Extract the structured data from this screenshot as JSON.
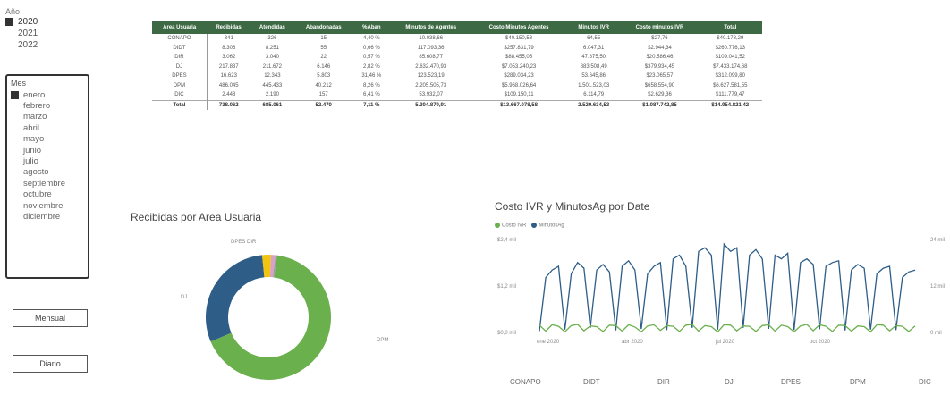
{
  "year_slicer": {
    "title": "Año",
    "items": [
      {
        "label": "2020",
        "selected": true
      },
      {
        "label": "2021",
        "selected": false
      },
      {
        "label": "2022",
        "selected": false
      }
    ]
  },
  "month_slicer": {
    "title": "Mes",
    "items": [
      {
        "label": "enero",
        "selected": true
      },
      {
        "label": "febrero",
        "selected": false
      },
      {
        "label": "marzo",
        "selected": false
      },
      {
        "label": "abril",
        "selected": false
      },
      {
        "label": "mayo",
        "selected": false
      },
      {
        "label": "junio",
        "selected": false
      },
      {
        "label": "julio",
        "selected": false
      },
      {
        "label": "agosto",
        "selected": false
      },
      {
        "label": "septiembre",
        "selected": false
      },
      {
        "label": "octubre",
        "selected": false
      },
      {
        "label": "noviembre",
        "selected": false
      },
      {
        "label": "diciembre",
        "selected": false
      }
    ]
  },
  "buttons": {
    "mensual": "Mensual",
    "diario": "Diario"
  },
  "table": {
    "headers": [
      "Area Usuaria",
      "Recibidas",
      "Atendidas",
      "Abandonadas",
      "%Aban",
      "Minutos de Agentes",
      "Costo Minutos Agentes",
      "Minutos IVR",
      "Costo minutos IVR",
      "Total"
    ],
    "rows": [
      [
        "CONAPO",
        "341",
        "326",
        "15",
        "4,40 %",
        "10.038,66",
        "$40.150,53",
        "64,55",
        "$27,76",
        "$40.178,29"
      ],
      [
        "DIDT",
        "8.306",
        "8.251",
        "55",
        "0,66 %",
        "117.093,36",
        "$257.831,79",
        "6.047,31",
        "$2.944,34",
        "$260.776,13"
      ],
      [
        "DIR",
        "3.062",
        "3.040",
        "22",
        "0,57 %",
        "85.608,77",
        "$88.455,05",
        "47.875,50",
        "$20.586,46",
        "$109.041,52"
      ],
      [
        "DJ",
        "217.837",
        "211.672",
        "6.146",
        "2,82 %",
        "2.632.470,93",
        "$7.053.240,23",
        "883.508,49",
        "$379.934,45",
        "$7.433.174,68"
      ],
      [
        "DPES",
        "16.623",
        "12.343",
        "5.803",
        "31,46 %",
        "123.523,19",
        "$289.034,23",
        "53.645,86",
        "$23.065,57",
        "$312.099,80"
      ],
      [
        "DPM",
        "486.045",
        "445.433",
        "40.212",
        "8,26 %",
        "2.205.505,73",
        "$5.968.026,64",
        "1.501.523,03",
        "$658.554,90",
        "$6.627.581,55"
      ],
      [
        "DIC",
        "2.448",
        "2.190",
        "157",
        "6,41 %",
        "53.932,07",
        "$109.150,11",
        "6.114,79",
        "$2.629,36",
        "$111.779,47"
      ]
    ],
    "total": [
      "Total",
      "738.062",
      "685.061",
      "52.470",
      "7,11 %",
      "5.304.879,91",
      "$13.667.078,58",
      "2.529.634,53",
      "$1.087.742,85",
      "$14.954.821,42"
    ]
  },
  "donut": {
    "title": "Recibidas por Area Usuaria",
    "slice_labels": {
      "top": "DPES DIR",
      "left": "DJ",
      "right": "DPM"
    },
    "colors": [
      "#6ab04c",
      "#2e5d88",
      "#f1c40f",
      "#d9a0c8",
      "#9b9b9b"
    ]
  },
  "line_chart": {
    "title": "Costo IVR y MinutosAg por Date",
    "legend": [
      {
        "name": "Costo IVR",
        "color": "#6ab04c"
      },
      {
        "name": "MinutosAg",
        "color": "#2e5d88"
      }
    ],
    "y_left_labels": [
      "$2,4 mil",
      "$1,2 mil",
      "$0,0 mil"
    ],
    "y_right_labels": [
      "24 mil",
      "12 mil",
      "0 mil"
    ],
    "x_labels": [
      "ene 2020",
      "abr 2020",
      "jul 2020",
      "oct 2020"
    ]
  },
  "bottom_axis": [
    "CONAPO",
    "DIDT",
    "DIR",
    "DJ",
    "DPES",
    "DPM",
    "DIC"
  ],
  "chart_data": [
    {
      "type": "table",
      "title": "",
      "columns": [
        "Area Usuaria",
        "Recibidas",
        "Atendidas",
        "Abandonadas",
        "%Aban",
        "Minutos de Agentes",
        "Costo Minutos Agentes",
        "Minutos IVR",
        "Costo minutos IVR",
        "Total"
      ]
    },
    {
      "type": "pie",
      "title": "Recibidas por Area Usuaria",
      "categories": [
        "DPM",
        "DJ",
        "DPES",
        "DIDT",
        "DIR"
      ],
      "values": [
        486045,
        217837,
        16623,
        8306,
        3062
      ]
    },
    {
      "type": "line",
      "title": "Costo IVR y MinutosAg por Date",
      "series": [
        {
          "name": "Costo IVR",
          "values": [
            220,
            60,
            230,
            190,
            40,
            210,
            240,
            70,
            200,
            180,
            50,
            220,
            210,
            60,
            230,
            170,
            40,
            200,
            230,
            80,
            210,
            190,
            50,
            220,
            240,
            60,
            210,
            180,
            40,
            230,
            220,
            70,
            200,
            190,
            50,
            210,
            230,
            60,
            220,
            180,
            40,
            200,
            240,
            70,
            230,
            190,
            50,
            220,
            210,
            60,
            200,
            180,
            40,
            230,
            220,
            70,
            210,
            190,
            50,
            200
          ]
        },
        {
          "name": "MinutosAg",
          "values": [
            60,
            1500,
            1700,
            1800,
            100,
            1600,
            1900,
            1750,
            150,
            1700,
            1850,
            1650,
            80,
            1800,
            1950,
            1700,
            120,
            1600,
            1800,
            1900,
            90,
            2000,
            2100,
            1800,
            150,
            2200,
            2300,
            2100,
            100,
            2400,
            2200,
            2300,
            150,
            2100,
            2250,
            2000,
            120,
            2100,
            2000,
            2150,
            90,
            1900,
            2000,
            1850,
            110,
            1800,
            1900,
            1950,
            80,
            1700,
            1850,
            1750,
            100,
            1600,
            1750,
            1800,
            90,
            1500,
            1650,
            1700
          ]
        }
      ],
      "ylim": [
        0,
        2400
      ]
    }
  ]
}
